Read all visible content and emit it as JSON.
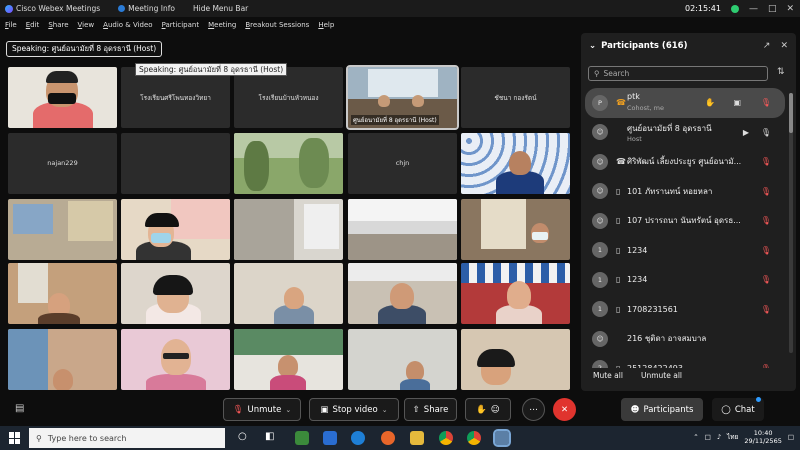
{
  "titlebar": {
    "app": "Cisco Webex Meetings",
    "meeting_info": "Meeting Info",
    "hide_menu": "Hide Menu Bar",
    "clock": "02:15:41"
  },
  "menu": [
    "File",
    "Edit",
    "Share",
    "View",
    "Audio & Video",
    "Participant",
    "Meeting",
    "Breakout Sessions",
    "Help"
  ],
  "speaking": {
    "label": "Speaking: ศูนย์อนามัยที่ 8 อุดรธานี (Host)",
    "tooltip": "Speaking: ศูนย์อนามัยที่ 8 อุดรธานี (Host)"
  },
  "tiles": {
    "t2": "โรงเรียนศรีโพนทองวิทยา",
    "t3": "โรงเรียนบ้านหัวหนอง",
    "t4": "ศูนย์อนามัยที่ 8 อุดรธานี (Host)",
    "t5": "ชัชนา กองรัตน์",
    "t6": "najan229",
    "t9": "chjn"
  },
  "participants": {
    "title": "Participants (616)",
    "search_placeholder": "Search",
    "rows": [
      {
        "avatar": "P",
        "name": "ptk",
        "sub": "Cohost, me"
      },
      {
        "avatar": "",
        "name": "ศูนย์อนามัยที่ 8 อุดรธานี",
        "sub": "Host"
      },
      {
        "avatar": "",
        "name": "ศิริพัฒน์ เลี้ยงประยูร ศูนย์อนามั...",
        "sub": ""
      },
      {
        "avatar": "1",
        "name": "101 ภัทรานทน์ หอยหลา",
        "sub": ""
      },
      {
        "avatar": "1",
        "name": "107 ปรารถนา นันทรัตน์ อุดรธ...",
        "sub": ""
      },
      {
        "avatar": "1",
        "name": "1234",
        "sub": ""
      },
      {
        "avatar": "1",
        "name": "1234",
        "sub": ""
      },
      {
        "avatar": "1",
        "name": "1708231561",
        "sub": ""
      },
      {
        "avatar": "",
        "name": "216 ชุติดา อาจสมบาล",
        "sub": ""
      },
      {
        "avatar": "2",
        "name": "25128422493",
        "sub": ""
      }
    ],
    "mute_all": "Mute all",
    "unmute_all": "Unmute all"
  },
  "controls": {
    "unmute": "Unmute",
    "stop_video": "Stop video",
    "share": "Share",
    "participants": "Participants",
    "chat": "Chat"
  },
  "taskbar": {
    "search_placeholder": "Type here to search",
    "lang": "ไทย",
    "time": "10:40",
    "date": "29/11/2565"
  }
}
